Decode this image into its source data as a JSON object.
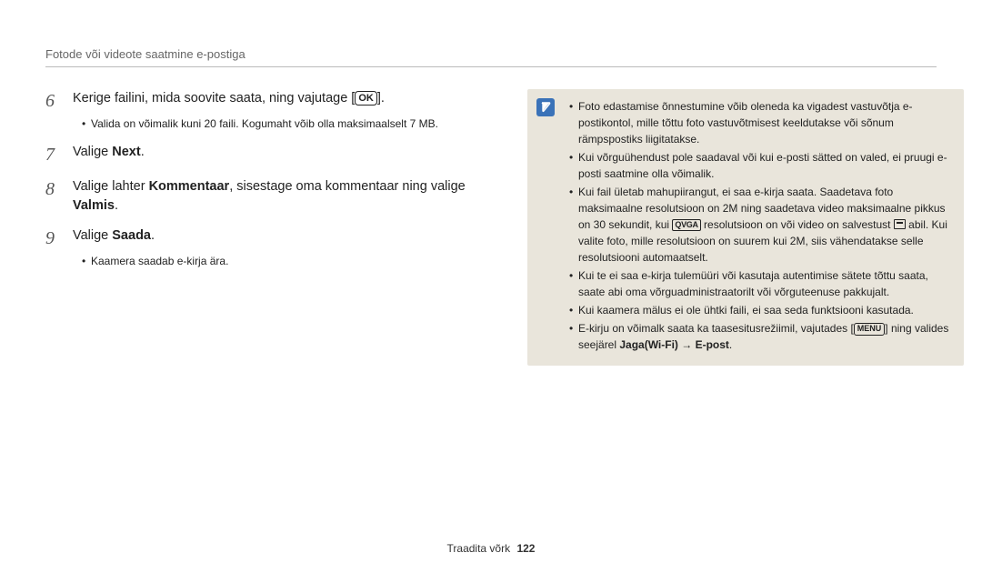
{
  "breadcrumb": "Fotode või videote saatmine e-postiga",
  "steps": [
    {
      "num": "6",
      "text_pre": "Kerige failini, mida soovite saata, ning vajutage [",
      "ok": "OK",
      "text_post": "].",
      "sub": [
        "Valida on võimalik kuni 20 faili. Kogumaht võib olla maksimaalselt 7 MB."
      ]
    },
    {
      "num": "7",
      "text_pre": "Valige ",
      "bold": "Next",
      "text_post": "."
    },
    {
      "num": "8",
      "text_pre": "Valige lahter ",
      "bold": "Kommentaar",
      "text_mid": ", sisestage oma kommentaar ning valige ",
      "bold2": "Valmis",
      "text_post": "."
    },
    {
      "num": "9",
      "text_pre": "Valige ",
      "bold": "Saada",
      "text_post": ".",
      "sub": [
        "Kaamera saadab e-kirja ära."
      ]
    }
  ],
  "note_icon_name": "note-icon",
  "notes": {
    "b1": "Foto edastamise õnnestumine võib oleneda ka vigadest vastuvõtja e-postikontol, mille tõttu foto vastuvõtmisest keeldutakse või sõnum rämpspostiks liigitatakse.",
    "b2": "Kui võrguühendust pole saadaval või kui e-posti sätted on valed, ei pruugi e-posti saatmine olla võimalik.",
    "b3_pre": "Kui fail ületab mahupiirangut, ei saa e-kirja saata. Saadetava foto maksimaalne resolutsioon on 2M ning saadetava video maksimaalne pikkus on 30 sekundit, kui ",
    "b3_qvga": "QVGA",
    "b3_mid": " resolutsioon on või video on salvestust ",
    "b3_post": " abil. Kui valite foto, mille resolutsioon on suurem kui 2M, siis vähendatakse selle resolutsiooni automaatselt.",
    "b4": "Kui te ei saa e-kirja tulemüüri või kasutaja autentimise sätete tõttu saata, saate abi oma võrguadministraatorilt või võrguteenuse pakkujalt.",
    "b5": "Kui kaamera mälus ei ole ühtki faili, ei saa seda funktsiooni kasutada.",
    "b6_pre": "E-kirju on võimalk saata ka taasesitusrežiimil, vajutades [",
    "b6_menu": "MENU",
    "b6_mid": "] ning valides seejärel ",
    "b6_bold": "Jaga(Wi-Fi) → E-post",
    "b6_post": "."
  },
  "footer": {
    "section": "Traadita võrk",
    "page": "122"
  }
}
